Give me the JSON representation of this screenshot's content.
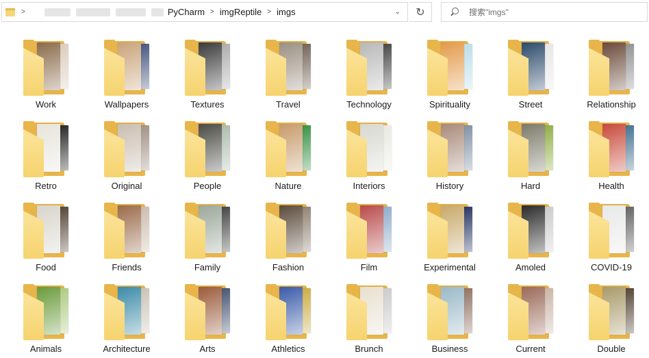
{
  "address_bar": {
    "path": [
      "PyCharm",
      "imgReptile",
      "imgs"
    ],
    "separator": ">",
    "dropdown_glyph": "⌄"
  },
  "refresh_glyph": "↻",
  "search": {
    "placeholder": "搜索\"imgs\""
  },
  "folders": [
    {
      "label": "Work",
      "c1": "#8a6a4a",
      "c2": "#d9c9b8"
    },
    {
      "label": "Wallpapers",
      "c1": "#c9a37a",
      "c2": "#3b4c7a"
    },
    {
      "label": "Textures",
      "c1": "#3a3a3a",
      "c2": "#a8a8a8"
    },
    {
      "label": "Travel",
      "c1": "#9a8e80",
      "c2": "#6b5b4c"
    },
    {
      "label": "Technology",
      "c1": "#b8b8b8",
      "c2": "#3c3c3c"
    },
    {
      "label": "Spirituality",
      "c1": "#e39a4a",
      "c2": "#b8dce8"
    },
    {
      "label": "Street",
      "c1": "#2b4a6b",
      "c2": "#e5e5e5"
    },
    {
      "label": "Relationship",
      "c1": "#6a4a3a",
      "c2": "#8a8a8a"
    },
    {
      "label": "Retro",
      "c1": "#e8e4dc",
      "c2": "#1a1a1a"
    },
    {
      "label": "Original",
      "c1": "#c9bdb0",
      "c2": "#9a8a7c"
    },
    {
      "label": "People",
      "c1": "#4a4a44",
      "c2": "#a8b8a8"
    },
    {
      "label": "Nature",
      "c1": "#c69a6a",
      "c2": "#2b8a3a"
    },
    {
      "label": "Interiors",
      "c1": "#d8d8d0",
      "c2": "#e8e8e0"
    },
    {
      "label": "History",
      "c1": "#a88a7a",
      "c2": "#7a8aa0"
    },
    {
      "label": "Hard",
      "c1": "#7a7a6a",
      "c2": "#8aaa3a"
    },
    {
      "label": "Health",
      "c1": "#c84a3a",
      "c2": "#3a6a8a"
    },
    {
      "label": "Food",
      "c1": "#d8d4cc",
      "c2": "#4a3a2a"
    },
    {
      "label": "Friends",
      "c1": "#9a6a4a",
      "c2": "#c8b8a8"
    },
    {
      "label": "Family",
      "c1": "#9aa89a",
      "c2": "#3a3a3a"
    },
    {
      "label": "Fashion",
      "c1": "#5a4a3a",
      "c2": "#8a7a6a"
    },
    {
      "label": "Film",
      "c1": "#b84a4a",
      "c2": "#8aa8c8"
    },
    {
      "label": "Experimental",
      "c1": "#c8a86a",
      "c2": "#1a2a5a"
    },
    {
      "label": "Amoled",
      "c1": "#2a2a2a",
      "c2": "#c8c8c8"
    },
    {
      "label": "COVID-19",
      "c1": "#e8e8e8",
      "c2": "#5a5a5a"
    },
    {
      "label": "Animals",
      "c1": "#6a9a3a",
      "c2": "#a8c87a"
    },
    {
      "label": "Architecture",
      "c1": "#3a8aa8",
      "c2": "#c8c0b0"
    },
    {
      "label": "Arts",
      "c1": "#9a5a3a",
      "c2": "#3a4a6a"
    },
    {
      "label": "Athletics",
      "c1": "#3a5aa8",
      "c2": "#c8a83a"
    },
    {
      "label": "Brunch",
      "c1": "#e8e0d0",
      "c2": "#c8c8c8"
    },
    {
      "label": "Business",
      "c1": "#9ab8c8",
      "c2": "#8a6a5a"
    },
    {
      "label": "Current",
      "c1": "#9a6a5a",
      "c2": "#c8b0a0"
    },
    {
      "label": "Double",
      "c1": "#a89a6a",
      "c2": "#4a3a2a"
    }
  ]
}
